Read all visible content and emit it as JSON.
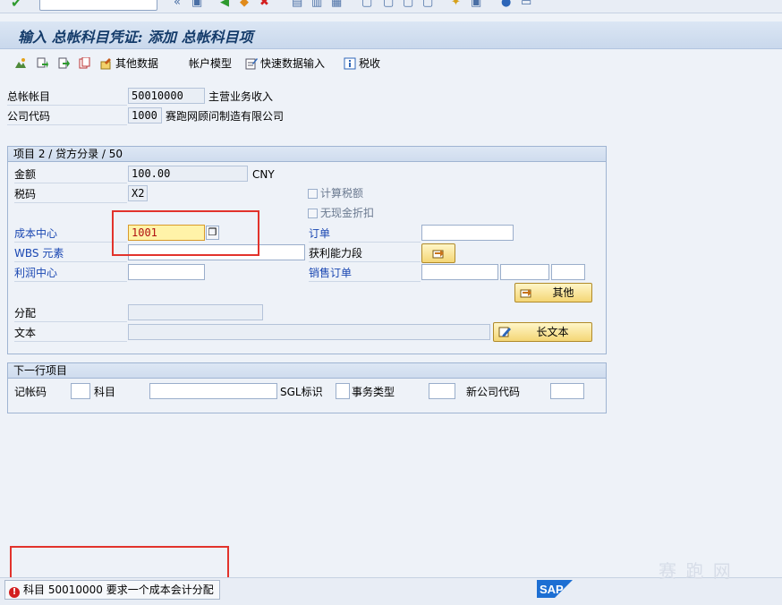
{
  "title": "输入 总帐科目凭证: 添加 总帐科目项",
  "toolbar": {
    "other_data": "其他数据",
    "account_model": "帐户模型",
    "fast_entry": "快速数据输入",
    "taxes": "税收"
  },
  "header": {
    "gl_account_label": "总帐帐目",
    "gl_account_value": "50010000",
    "gl_account_desc": "主营业务收入",
    "company_code_label": "公司代码",
    "company_code_value": "1000",
    "company_code_desc": "赛跑网顾问制造有限公司"
  },
  "item": {
    "title": "项目 2 / 贷方分录 / 50",
    "amount_label": "金额",
    "amount_value": "100.00",
    "currency": "CNY",
    "tax_code_label": "税码",
    "tax_code_value": "X2",
    "calc_tax_label": "计算税额",
    "no_cash_discount_label": "无现金折扣",
    "cost_center_label": "成本中心",
    "cost_center_value": "1001",
    "order_label": "订单",
    "wbs_label": "WBS 元素",
    "profitability_label": "获利能力段",
    "profit_center_label": "利润中心",
    "sales_order_label": "销售订单",
    "more_button": "其他",
    "assignment_label": "分配",
    "text_label": "文本",
    "long_text_button": "长文本"
  },
  "next_item": {
    "title": "下一行项目",
    "posting_key_label": "记帐码",
    "account_label": "科目",
    "sgl_label": "SGL标识",
    "trans_type_label": "事务类型",
    "new_company_label": "新公司代码"
  },
  "status": {
    "message": "科目 50010000 要求一个成本会计分配",
    "type": "error"
  },
  "branding": {
    "sap_logo": "SAP",
    "watermark": "赛 跑 网"
  },
  "colors": {
    "error": "#d31f1f",
    "focus_field": "#fff3a8",
    "annotation_red": "#e2332c",
    "sap_blue": "#1d6fd3"
  }
}
